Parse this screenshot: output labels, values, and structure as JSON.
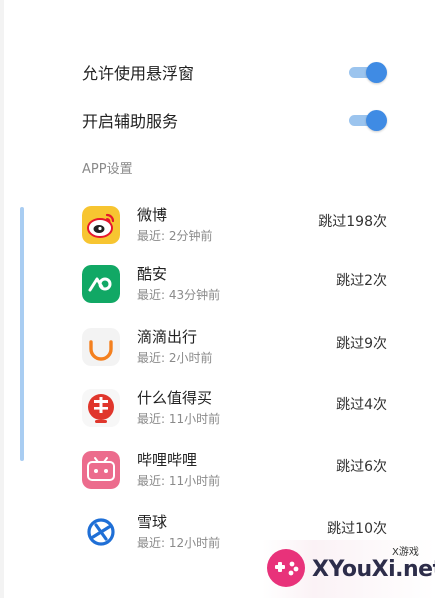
{
  "settings": [
    {
      "label": "允许使用悬浮窗",
      "enabled": true
    },
    {
      "label": "开启辅助服务",
      "enabled": true
    }
  ],
  "section_title": "APP设置",
  "apps": [
    {
      "name": "微博",
      "last": "最近: 2分钟前",
      "skip": "跳过198次",
      "icon": "weibo-icon"
    },
    {
      "name": "酷安",
      "last": "最近: 43分钟前",
      "skip": "跳过2次",
      "icon": "coolapk-icon"
    },
    {
      "name": "滴滴出行",
      "last": "最近: 2小时前",
      "skip": "跳过9次",
      "icon": "didi-icon"
    },
    {
      "name": "什么值得买",
      "last": "最近: 11小时前",
      "skip": "跳过4次",
      "icon": "smzdm-icon"
    },
    {
      "name": "哔哩哔哩",
      "last": "最近: 11小时前",
      "skip": "跳过6次",
      "icon": "bilibili-icon"
    },
    {
      "name": "雪球",
      "last": "最近: 12小时前",
      "skip": "跳过10次",
      "icon": "xueqiu-icon"
    }
  ],
  "colors": {
    "accent": "#3f8be4",
    "toggle_track": "#9bc4ee",
    "scroll_indicator": "#a9cdf2"
  },
  "watermark": {
    "small": "X游戏",
    "text": "XYouXi.net"
  }
}
